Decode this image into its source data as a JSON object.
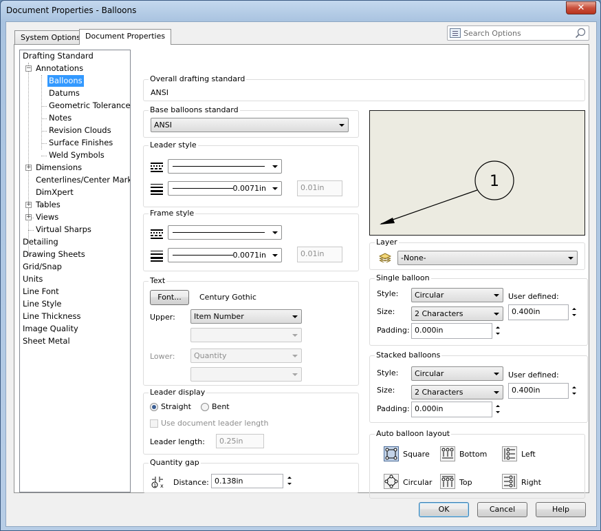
{
  "window": {
    "title": "Document Properties - Balloons",
    "close_label": "✕"
  },
  "tabs": [
    {
      "label": "System Options"
    },
    {
      "label": "Document Properties"
    }
  ],
  "search": {
    "placeholder": "Search Options"
  },
  "tree": {
    "items": [
      {
        "label": "Drafting Standard"
      },
      {
        "label": "Annotations"
      },
      {
        "label": "Balloons"
      },
      {
        "label": "Datums"
      },
      {
        "label": "Geometric Tolerances"
      },
      {
        "label": "Notes"
      },
      {
        "label": "Revision Clouds"
      },
      {
        "label": "Surface Finishes"
      },
      {
        "label": "Weld Symbols"
      },
      {
        "label": "Dimensions"
      },
      {
        "label": "Centerlines/Center Marks"
      },
      {
        "label": "DimXpert"
      },
      {
        "label": "Tables"
      },
      {
        "label": "Views"
      },
      {
        "label": "Virtual Sharps"
      },
      {
        "label": "Detailing"
      },
      {
        "label": "Drawing Sheets"
      },
      {
        "label": "Grid/Snap"
      },
      {
        "label": "Units"
      },
      {
        "label": "Line Font"
      },
      {
        "label": "Line Style"
      },
      {
        "label": "Line Thickness"
      },
      {
        "label": "Image Quality"
      },
      {
        "label": "Sheet Metal"
      }
    ]
  },
  "overall": {
    "title": "Overall drafting standard",
    "value": "ANSI"
  },
  "base": {
    "title": "Base balloons standard",
    "value": "ANSI"
  },
  "leader_style": {
    "title": "Leader style",
    "thickness": "0.0071in",
    "custom": "0.01in"
  },
  "frame_style": {
    "title": "Frame style",
    "thickness": "0.0071in",
    "custom": "0.01in"
  },
  "text": {
    "title": "Text",
    "font_button": "Font...",
    "font_name": "Century Gothic",
    "upper_label": "Upper:",
    "upper_value": "Item Number",
    "lower_label": "Lower:",
    "lower_value": "Quantity"
  },
  "leader_display": {
    "title": "Leader display",
    "straight": "Straight",
    "bent": "Bent",
    "use_doc_length": "Use document leader length",
    "length_label": "Leader length:",
    "length_value": "0.25in"
  },
  "quantity_gap": {
    "title": "Quantity gap",
    "distance_label": "Distance:",
    "distance_value": "0.138in"
  },
  "preview": {
    "balloon_text": "1"
  },
  "layer": {
    "title": "Layer",
    "value": "-None-"
  },
  "single": {
    "title": "Single balloon",
    "style_label": "Style:",
    "style_value": "Circular",
    "size_label": "Size:",
    "size_value": "2 Characters",
    "user_defined_label": "User defined:",
    "user_defined_value": "0.400in",
    "padding_label": "Padding:",
    "padding_value": "0.000in"
  },
  "stacked": {
    "title": "Stacked balloons",
    "style_label": "Style:",
    "style_value": "Circular",
    "size_label": "Size:",
    "size_value": "2 Characters",
    "user_defined_label": "User defined:",
    "user_defined_value": "0.400in",
    "padding_label": "Padding:",
    "padding_value": "0.000in"
  },
  "auto_layout": {
    "title": "Auto balloon layout",
    "options": [
      {
        "label": "Square",
        "icon": "square-layout-icon"
      },
      {
        "label": "Bottom",
        "icon": "bottom-layout-icon"
      },
      {
        "label": "Left",
        "icon": "left-layout-icon"
      },
      {
        "label": "Circular",
        "icon": "circular-layout-icon"
      },
      {
        "label": "Top",
        "icon": "top-layout-icon"
      },
      {
        "label": "Right",
        "icon": "right-layout-icon"
      }
    ]
  },
  "buttons": {
    "ok": "OK",
    "cancel": "Cancel",
    "help": "Help"
  }
}
